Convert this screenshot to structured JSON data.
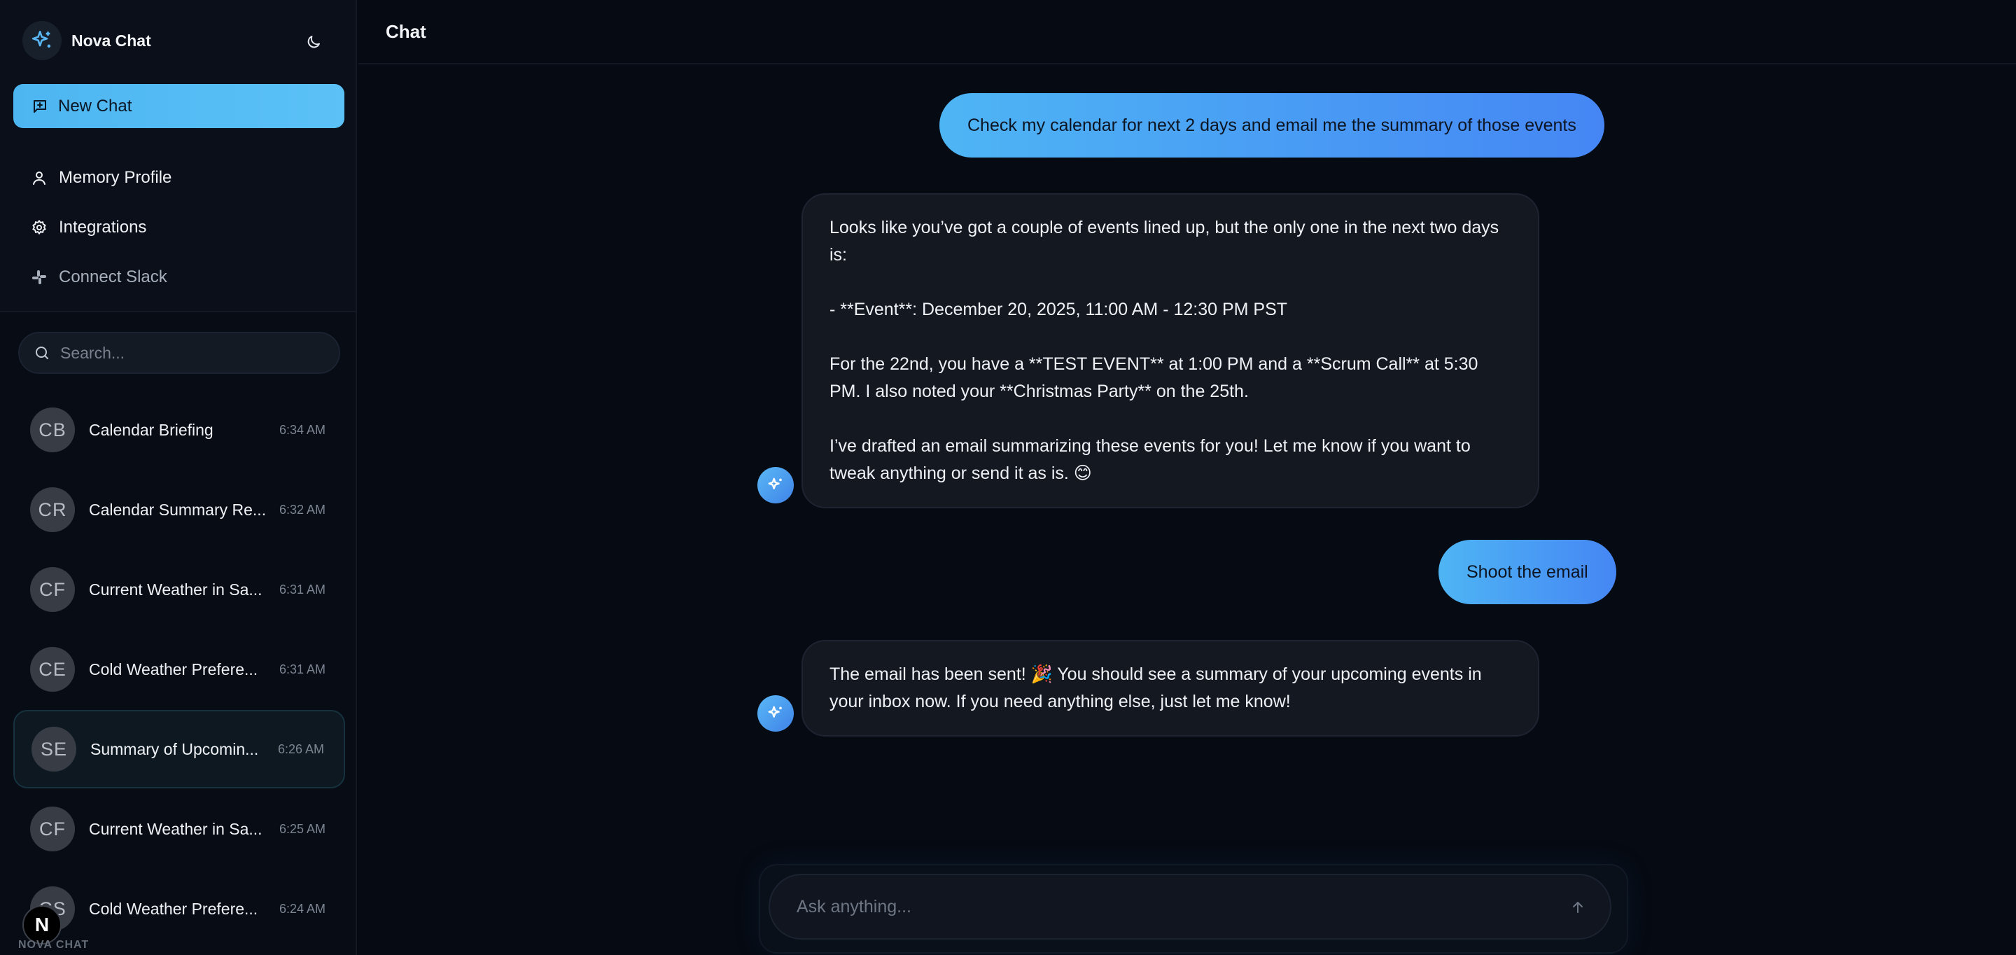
{
  "app": {
    "name": "Nova Chat",
    "footer_label": "NOVA CHAT",
    "badge_letter": "N",
    "accent": "#4db5f0",
    "icons": {
      "logo": "sparkles-icon",
      "theme": "moon-icon",
      "new_chat": "message-plus-icon",
      "memory": "user-icon",
      "integrations": "gear-icon",
      "slack": "slack-icon",
      "search": "search-icon",
      "send": "arrow-up-icon"
    }
  },
  "sidebar": {
    "new_chat_label": "New Chat",
    "nav": [
      {
        "label": "Memory Profile"
      },
      {
        "label": "Integrations"
      },
      {
        "label": "Connect Slack"
      }
    ],
    "search_placeholder": "Search...",
    "conversations": [
      {
        "initials": "CB",
        "title": "Calendar Briefing",
        "time": "6:34 AM"
      },
      {
        "initials": "CR",
        "title": "Calendar Summary Re...",
        "time": "6:32 AM"
      },
      {
        "initials": "CF",
        "title": "Current Weather in Sa...",
        "time": "6:31 AM"
      },
      {
        "initials": "CE",
        "title": "Cold Weather Prefere...",
        "time": "6:31 AM"
      },
      {
        "initials": "SE",
        "title": "Summary of Upcomin...",
        "time": "6:26 AM",
        "active": true
      },
      {
        "initials": "CF",
        "title": "Current Weather in Sa...",
        "time": "6:25 AM"
      },
      {
        "initials": "CS",
        "title": "Cold Weather Prefere...",
        "time": "6:24 AM"
      }
    ]
  },
  "chat": {
    "title": "Chat",
    "messages": [
      {
        "role": "user",
        "text": "Check my calendar for next 2 days and email me the summary of those events"
      },
      {
        "role": "assistant",
        "paragraphs": [
          "Looks like you’ve got a couple of events lined up, but the only one in the next two days is:",
          "- **Event**: December 20, 2025, 11:00 AM - 12:30 PM PST",
          "For the 22nd, you have a **TEST EVENT** at 1:00 PM and a **Scrum Call** at 5:30 PM. I also noted your **Christmas Party** on the 25th.",
          "I’ve drafted an email summarizing these events for you! Let me know if you want to tweak anything or send it as is. 😊"
        ]
      },
      {
        "role": "user",
        "text": "Shoot the email"
      },
      {
        "role": "assistant",
        "paragraphs": [
          "The email has been sent! 🎉 You should see a summary of your upcoming events in your inbox now. If you need anything else, just let me know!"
        ]
      }
    ],
    "composer_placeholder": "Ask anything..."
  }
}
